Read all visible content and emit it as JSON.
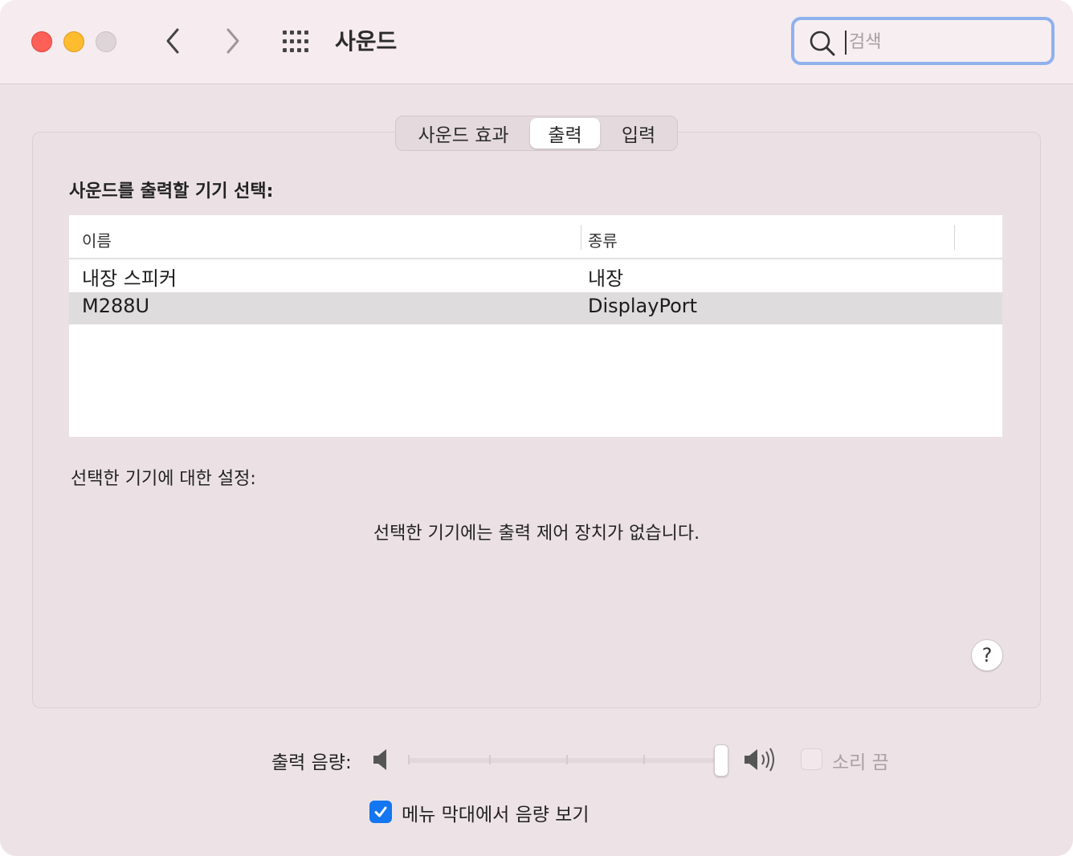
{
  "window": {
    "title": "사운드"
  },
  "search": {
    "placeholder": "검색",
    "value": ""
  },
  "tabs": [
    {
      "label": "사운드 효과",
      "selected": false
    },
    {
      "label": "출력",
      "selected": true
    },
    {
      "label": "입력",
      "selected": false
    }
  ],
  "output": {
    "section_label": "사운드를 출력할 기기 선택:",
    "columns": {
      "name": "이름",
      "type": "종류"
    },
    "devices": [
      {
        "name": "내장 스피커",
        "type": "내장",
        "selected": false
      },
      {
        "name": "M288U",
        "type": "DisplayPort",
        "selected": true
      }
    ],
    "settings_label": "선택한 기기에 대한 설정:",
    "no_controls_message": "선택한 기기에는 출력 제어 장치가 없습니다.",
    "help_label": "?"
  },
  "volume": {
    "label": "출력 음량:",
    "level": 1.0,
    "mute_label": "소리 끔",
    "mute_checked": false,
    "mute_enabled": false,
    "show_in_menubar_label": "메뉴 막대에서 음량 보기",
    "show_in_menubar_checked": true
  },
  "colors": {
    "accent": "#1476f0",
    "search_focus_ring": "#8fb1ee",
    "close": "#fe5f57",
    "minimize": "#febc2e",
    "zoom_disabled": "#ddd5d8"
  }
}
